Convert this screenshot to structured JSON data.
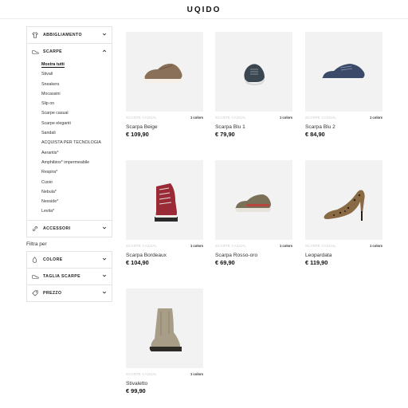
{
  "brand": "UQIDO",
  "sidebar": {
    "abbigliamento": "ABBIGLIAMENTO",
    "scarpe": "SCARPE",
    "scarpe_items": [
      "Mostra tutti",
      "Stivali",
      "Sneakers",
      "Mocassini",
      "Slip on",
      "Scarpe casual",
      "Scarpe eleganti",
      "Sandali",
      "ACQUISTA PER TECNOLOGIA",
      "Aerantis*",
      "Amphibiox* impermeabile",
      "Respira*",
      "Cuoio",
      "Nebula*",
      "Nexside*",
      "Levita*"
    ],
    "accessori": "ACCESSORI",
    "filtra_per": "Filtra per",
    "colore": "COLORE",
    "taglia": "TAGLIA SCARPE",
    "prezzo": "PREZZO"
  },
  "products": [
    {
      "category": "SCARPE CASUAL",
      "colors": "1 colors",
      "name": "Scarpa Beige",
      "price": "€ 109,90"
    },
    {
      "category": "SCARPE CASUAL",
      "colors": "1 colors",
      "name": "Scarpa Blu 1",
      "price": "€ 79,90"
    },
    {
      "category": "SCARPE CASUAL",
      "colors": "1 colors",
      "name": "Scarpa Blu 2",
      "price": "€ 84,90"
    },
    {
      "category": "SCARPE CASUAL",
      "colors": "1 colors",
      "name": "Scarpa Bordeaux",
      "price": "€ 104,90"
    },
    {
      "category": "SCARPE CASUAL",
      "colors": "1 colors",
      "name": "Scarpa Rosso-oro",
      "price": "€ 69,90"
    },
    {
      "category": "SCARPE CASUAL",
      "colors": "1 colors",
      "name": "Leopardata",
      "price": "€ 119,90"
    },
    {
      "category": "SCARPE CASUAL",
      "colors": "1 colors",
      "name": "Stivaletto",
      "price": "€ 99,90"
    }
  ]
}
